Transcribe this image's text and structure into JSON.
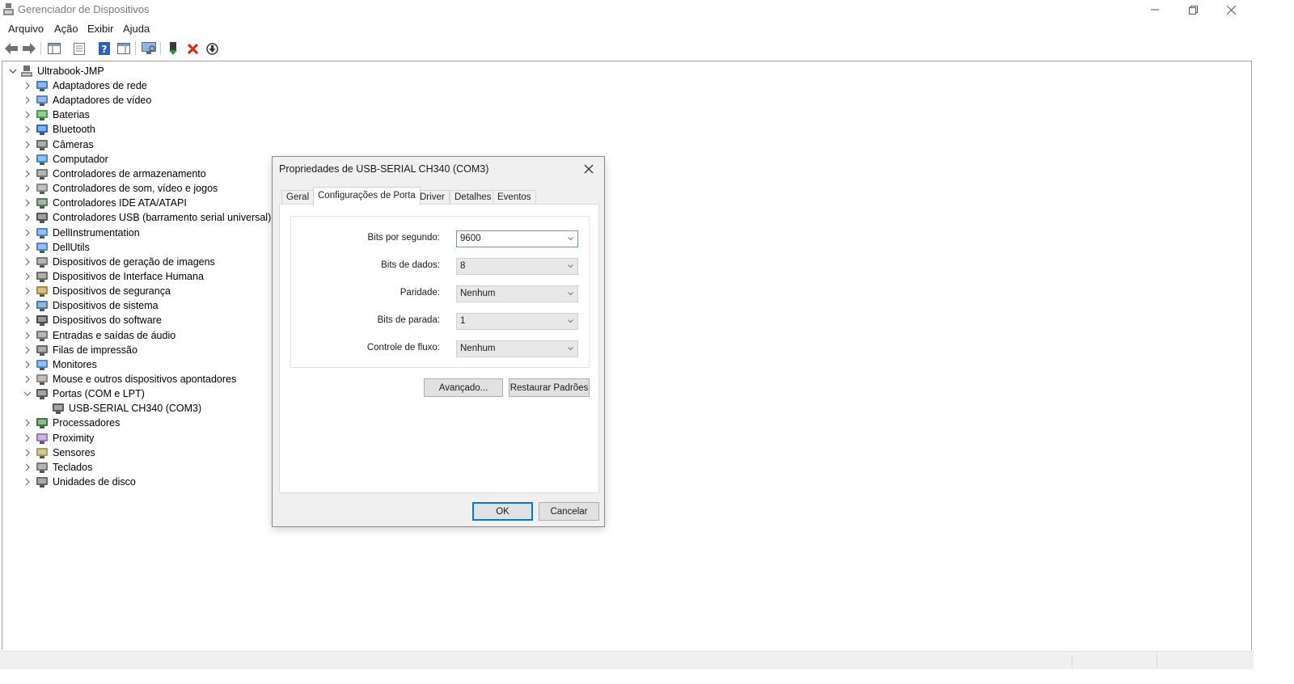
{
  "window": {
    "title": "Gerenciador de Dispositivos",
    "icon": "device-manager-icon"
  },
  "menu": [
    "Arquivo",
    "Ação",
    "Exibir",
    "Ajuda"
  ],
  "toolbar": {
    "icons": [
      "back-arrow-icon",
      "forward-arrow-icon",
      "show-hide-console-tree-icon",
      "properties-icon",
      "help-icon",
      "action-pane-icon",
      "monitor-scan-icon",
      "update-driver-icon",
      "uninstall-device-icon",
      "disable-device-icon"
    ]
  },
  "tree": {
    "root": "Ultrabook-JMP",
    "items": [
      {
        "label": "Adaptadores de rede",
        "icon": "network-adapter-icon"
      },
      {
        "label": "Adaptadores de vídeo",
        "icon": "display-adapter-icon"
      },
      {
        "label": "Baterias",
        "icon": "battery-icon"
      },
      {
        "label": "Bluetooth",
        "icon": "bluetooth-icon"
      },
      {
        "label": "Câmeras",
        "icon": "camera-icon"
      },
      {
        "label": "Computador",
        "icon": "computer-icon"
      },
      {
        "label": "Controladores de armazenamento",
        "icon": "storage-controller-icon"
      },
      {
        "label": "Controladores de som, vídeo e jogos",
        "icon": "speaker-icon"
      },
      {
        "label": "Controladores IDE ATA/ATAPI",
        "icon": "ide-controller-icon"
      },
      {
        "label": "Controladores USB (barramento serial universal)",
        "icon": "usb-icon"
      },
      {
        "label": "DellInstrumentation",
        "icon": "monitor-icon"
      },
      {
        "label": "DellUtils",
        "icon": "monitor-icon"
      },
      {
        "label": "Dispositivos de geração de imagens",
        "icon": "scanner-icon"
      },
      {
        "label": "Dispositivos de Interface Humana",
        "icon": "hid-icon"
      },
      {
        "label": "Dispositivos de segurança",
        "icon": "security-device-icon"
      },
      {
        "label": "Dispositivos de sistema",
        "icon": "system-device-icon"
      },
      {
        "label": "Dispositivos do software",
        "icon": "software-device-icon"
      },
      {
        "label": "Entradas e saídas de áudio",
        "icon": "audio-io-icon"
      },
      {
        "label": "Filas de impressão",
        "icon": "printer-icon"
      },
      {
        "label": "Monitores",
        "icon": "monitor-icon"
      },
      {
        "label": "Mouse e outros dispositivos apontadores",
        "icon": "mouse-icon"
      },
      {
        "label": "Portas (COM e LPT)",
        "icon": "port-icon",
        "expanded": true
      },
      {
        "label": "USB-SERIAL CH340 (COM3)",
        "icon": "port-icon",
        "child": true
      },
      {
        "label": "Processadores",
        "icon": "processor-icon"
      },
      {
        "label": "Proximity",
        "icon": "proximity-icon"
      },
      {
        "label": "Sensores",
        "icon": "sensor-icon"
      },
      {
        "label": "Teclados",
        "icon": "keyboard-icon"
      },
      {
        "label": "Unidades de disco",
        "icon": "disk-drive-icon"
      }
    ]
  },
  "dialog": {
    "title": "Propriedades de USB-SERIAL CH340 (COM3)",
    "tabs": [
      "Geral",
      "Configurações de Porta",
      "Driver",
      "Detalhes",
      "Eventos"
    ],
    "active_tab": "Configurações de Porta",
    "fields": [
      {
        "label": "Bits por segundo:",
        "value": "9600"
      },
      {
        "label": "Bits de dados:",
        "value": "8"
      },
      {
        "label": "Paridade:",
        "value": "Nenhum"
      },
      {
        "label": "Bits de parada:",
        "value": "1"
      },
      {
        "label": "Controle de fluxo:",
        "value": "Nenhum"
      }
    ],
    "advanced_label": "Avançado...",
    "restore_label": "Restaurar Padrões",
    "ok_label": "OK",
    "cancel_label": "Cancelar"
  },
  "colors": {
    "accent": "#0078d7",
    "dialog_bg": "#f0f0f0",
    "panel_border": "#a0a0a0"
  }
}
